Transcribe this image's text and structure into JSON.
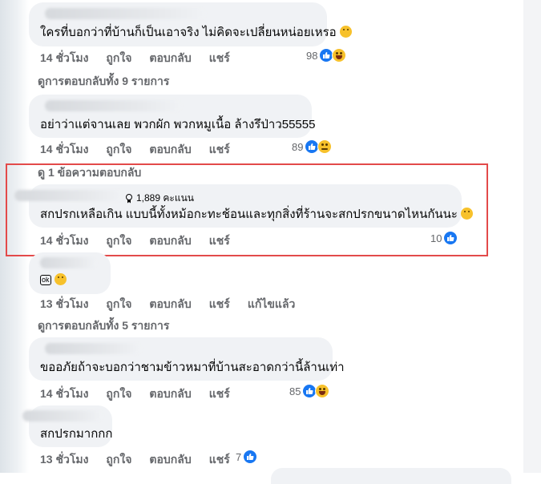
{
  "comments": [
    {
      "text": "ใครที่บอกว่าที่บ้านก็เป็นเอาจริง ไม่คิดจะเปลี่ยนหน่อยเหรอ",
      "time": "14 ชั่วโมง",
      "like": "ถูกใจ",
      "reply": "ตอบกลับ",
      "share": "แชร์",
      "reactions": "98",
      "view_replies": "ดูการตอบกลับทั้ง 9 รายการ"
    },
    {
      "text": "อย่าว่าแต่จานเลย พวกผัก พวกหมูเนื้อ ล้างรึป่าว55555",
      "time": "14 ชั่วโมง",
      "like": "ถูกใจ",
      "reply": "ตอบกลับ",
      "share": "แชร์",
      "reactions": "89",
      "view_replies": "ดู 1 ข้อความตอบกลับ"
    },
    {
      "badge": "1,889 คะแนน",
      "text": "สกปรกเหลือเกิน แบบนี้ทั้งหม้อกะทะช้อนและทุกสิ่งที่ร้านจะสกปรกขนาดไหนกันนะ",
      "time": "14 ชั่วโมง",
      "like": "ถูกใจ",
      "reply": "ตอบกลับ",
      "share": "แชร์",
      "reactions": "10"
    },
    {
      "tag": "ok",
      "time": "13 ชั่วโมง",
      "like": "ถูกใจ",
      "reply": "ตอบกลับ",
      "share": "แชร์",
      "edited": "แก้ไขแล้ว",
      "view_replies": "ดูการตอบกลับทั้ง 5 รายการ"
    },
    {
      "text": "ขออภัยถ้าจะบอกว่าชามข้าวหมาที่บ้านสะอาดกว่านี้ล้านเท่า",
      "time": "14 ชั่วโมง",
      "like": "ถูกใจ",
      "reply": "ตอบกลับ",
      "share": "แชร์",
      "reactions": "85"
    },
    {
      "text": "สกปรกมากกก",
      "time": "13 ชั่วโมง",
      "like": "ถูกใจ",
      "reply": "ตอบกลับ",
      "share": "แชร์",
      "reactions": "7"
    }
  ],
  "colors": {
    "like_blue": "#1877f2",
    "highlight_red": "#e34a4a",
    "bubble_bg": "#f0f2f5",
    "meta_gray": "#65676b"
  },
  "icons": [
    "like-icon",
    "laugh-emoji-icon",
    "sad-emoji-icon",
    "grin-emoji-icon",
    "medal-icon"
  ]
}
